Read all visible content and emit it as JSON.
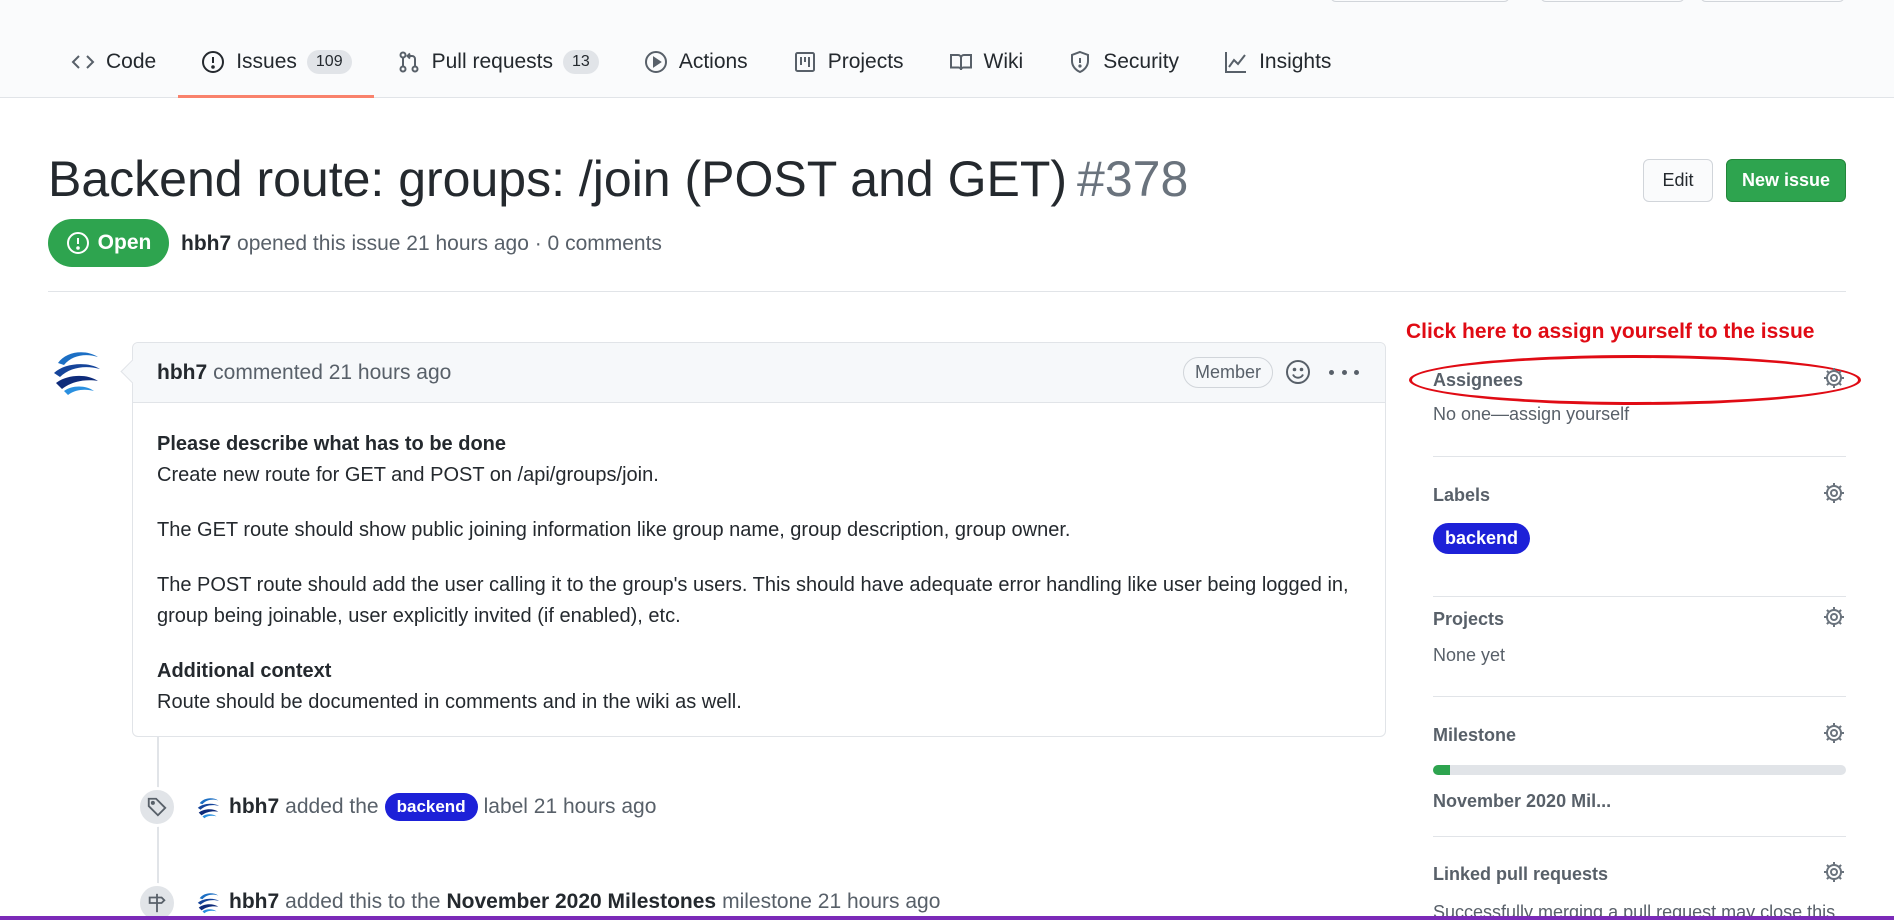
{
  "repo_nav": {
    "tabs": [
      {
        "label": "Code",
        "icon": "code-icon"
      },
      {
        "label": "Issues",
        "icon": "issue-opened-icon",
        "count": "109",
        "selected": true
      },
      {
        "label": "Pull requests",
        "icon": "git-pull-request-icon",
        "count": "13"
      },
      {
        "label": "Actions",
        "icon": "play-icon"
      },
      {
        "label": "Projects",
        "icon": "project-icon"
      },
      {
        "label": "Wiki",
        "icon": "book-icon"
      },
      {
        "label": "Security",
        "icon": "shield-icon"
      },
      {
        "label": "Insights",
        "icon": "graph-icon"
      }
    ]
  },
  "issue": {
    "title": "Backend route: groups: /join (POST and GET)",
    "number": "#378",
    "edit_label": "Edit",
    "new_issue_label": "New issue",
    "state": "Open",
    "author": "hbh7",
    "meta_rest": "opened this issue 21 hours ago · 0 comments"
  },
  "comment": {
    "author": "hbh7",
    "meta": "commented 21 hours ago",
    "role_badge": "Member",
    "body": {
      "heading1": "Please describe what has to be done",
      "p1": "Create new route for GET and POST on /api/groups/join.",
      "p2": "The GET route should show public joining information like group name, group description, group owner.",
      "p3": "The POST route should add the user calling it to the group's users. This should have adequate error handling like user being logged in, group being joinable, user explicitly invited (if enabled), etc.",
      "heading2": "Additional context",
      "p4": "Route should be documented in comments and in the wiki as well."
    }
  },
  "timeline": {
    "event1": {
      "author": "hbh7",
      "pre": "added the",
      "label": "backend",
      "post": "label 21 hours ago"
    },
    "event2": {
      "author": "hbh7",
      "pre": "added this to the",
      "milestone": "November 2020 Milestones",
      "post": "milestone 21 hours ago"
    }
  },
  "annotation": {
    "text": "Click here to assign yourself to the issue",
    "color": "#e00b14"
  },
  "sidebar": {
    "assignees": {
      "title": "Assignees",
      "value": "No one—assign yourself"
    },
    "labels": {
      "title": "Labels",
      "label": "backend",
      "label_color": "#1d21d8"
    },
    "projects": {
      "title": "Projects",
      "value": "None yet"
    },
    "milestone": {
      "title": "Milestone",
      "progress_percent": 4,
      "name": "November 2020 Mil..."
    },
    "linked_prs": {
      "title": "Linked pull requests",
      "value": "Successfully merging a pull request may close this"
    }
  },
  "colors": {
    "accent_green": "#2ea44f",
    "tab_underline": "#f9826c",
    "label_blue": "#1d21d8"
  }
}
